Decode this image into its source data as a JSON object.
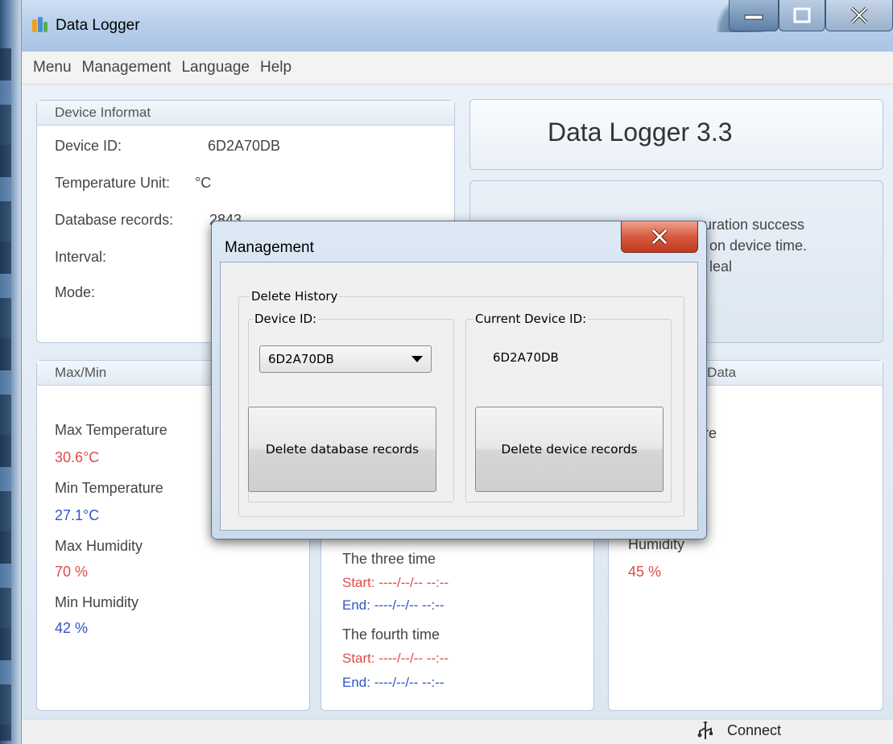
{
  "window": {
    "title": "Data Logger"
  },
  "menu": [
    "Menu",
    "Management",
    "Language",
    "Help"
  ],
  "device_info": {
    "title": "Device Informat",
    "device_id_label": "Device ID:",
    "device_id_value": "6D2A70DB",
    "temp_unit_label": "Temperature Unit:",
    "temp_unit_value": "°C",
    "db_records_label": "Database records:",
    "db_records_value_partial": "2843",
    "interval_label": "Interval:",
    "mode_label": "Mode:"
  },
  "app_header": {
    "title": "Data Logger 3.3"
  },
  "status_box": {
    "line1": "uration success",
    "line2": "on device time.",
    "line3": "leal"
  },
  "maxmin": {
    "title": "Max/Min",
    "max_temp_label": "Max Temperature",
    "max_temp_value": "30.6°C",
    "min_temp_label": "Min Temperature",
    "min_temp_value": "27.1°C",
    "max_hum_label": "Max Humidity",
    "max_hum_value": "70 %",
    "min_hum_label": "Min Humidity",
    "min_hum_value": "42 %"
  },
  "records": {
    "third_label": "The three time",
    "third_start": "Start:  ----/--/--  --:--",
    "third_end": "End:  ----/--/--  --:--",
    "fourth_label": "The fourth time",
    "fourth_start": "Start:  ----/--/--  --:--",
    "fourth_end": "End:  ----/--/--  --:--"
  },
  "realtime": {
    "title_partial": "e Data",
    "temp_partial": "ure",
    "humidity_label": "Humidity",
    "humidity_value": "45 %"
  },
  "status_bar": {
    "connect_label": "Connect"
  },
  "dialog": {
    "title": "Management",
    "group_title": "Delete History",
    "device_id_group": "Device ID:",
    "current_device_group": "Current Device ID:",
    "selected_device": "6D2A70DB",
    "current_device_value": "6D2A70DB",
    "delete_db_button": "Delete database records",
    "delete_device_button": "Delete device records"
  }
}
